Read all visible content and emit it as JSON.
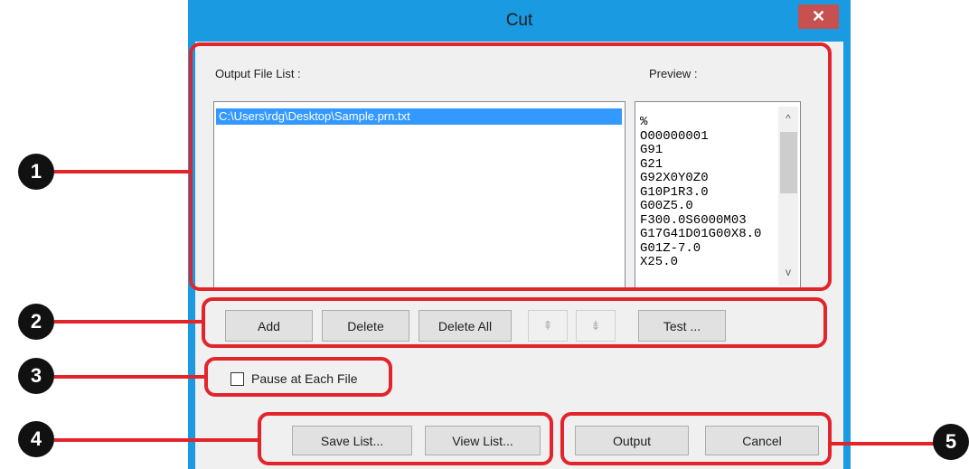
{
  "window": {
    "title": "Cut",
    "close_glyph": "✕"
  },
  "output_file_list": {
    "label": "Output File List :",
    "items": [
      "C:\\Users\\rdg\\Desktop\\Sample.prn.txt"
    ]
  },
  "preview": {
    "label": "Preview :",
    "lines": [
      "%",
      "O00000001",
      "G91",
      "G21",
      "G92X0Y0Z0",
      "G10P1R3.0",
      "G00Z5.0",
      "F300.0S6000M03",
      "G17G41D01G00X8.0",
      "G01Z-7.0",
      "X25.0"
    ],
    "scroll_up_glyph": "^",
    "scroll_down_glyph": "v"
  },
  "list_buttons": {
    "add": "Add",
    "delete": "Delete",
    "delete_all": "Delete All",
    "move_up_glyph": "⇞",
    "move_down_glyph": "⇟",
    "test": "Test ..."
  },
  "options": {
    "pause_label": "Pause at Each File",
    "pause_checked": false
  },
  "list_file_buttons": {
    "save": "Save List...",
    "view": "View List..."
  },
  "action_buttons": {
    "output": "Output",
    "cancel": "Cancel"
  },
  "callouts": [
    "1",
    "2",
    "3",
    "4",
    "5"
  ],
  "colors": {
    "title_bar": "#1a9ae0",
    "close_button": "#c75050",
    "highlight": "#e2242b",
    "selection": "#3399ff",
    "callout_badge": "#111111"
  }
}
